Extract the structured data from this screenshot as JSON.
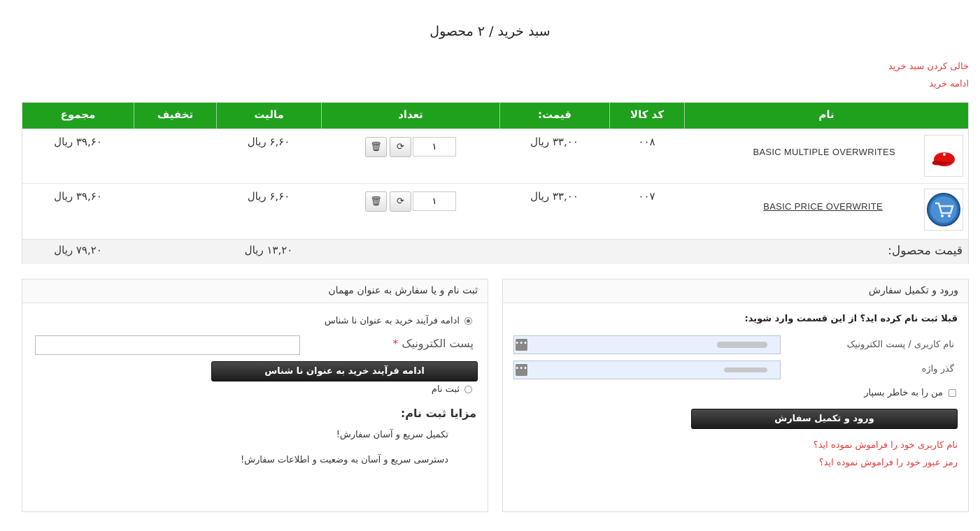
{
  "page": {
    "title": "سبد خرید / ۲ محصول"
  },
  "links": {
    "empty_cart": "خالی کردن سبد خرید",
    "continue_shopping": "ادامه خرید"
  },
  "table": {
    "headers": {
      "name": "نام",
      "sku": "کد کالا",
      "price": "قیمت:",
      "qty": "تعداد",
      "tax": "مالیت",
      "discount": "تخفیف",
      "total": "مجموع"
    },
    "rows": [
      {
        "name": "BASIC MULTIPLE OVERWRITES",
        "sku": "۰۰۸",
        "price": "۳۳,۰۰ ریال",
        "qty": "۱",
        "tax": "۶,۶۰ ریال",
        "discount": "",
        "total": "۳۹,۶۰ ریال",
        "image": "red-cap-icon"
      },
      {
        "name": "BASIC PRICE OVERWRITE",
        "sku": "۰۰۷",
        "price": "۳۳,۰۰ ریال",
        "qty": "۱",
        "tax": "۶,۶۰ ریال",
        "discount": "",
        "total": "۳۹,۶۰ ریال",
        "image": "shopping-cart-icon"
      }
    ],
    "summary": {
      "label": "قیمت محصول:",
      "tax": "۱۳,۲۰ ریال",
      "total": "۷۹,۲۰ ریال"
    }
  },
  "login": {
    "title": "ورود و تکمیل سفارش",
    "intro": "قبلا ثبت نام کرده اید؟ از این قسمت وارد شوید:",
    "username_label": "نام کاربری / پست الکترونیک",
    "password_label": "گذر واژه",
    "remember": "من را به خاطر بسپار",
    "submit": "ورود و تکمیل سفارش",
    "forgot_username": "نام کاربری خود را فراموش نموده اید؟",
    "forgot_password": "رمز عبور خود را فراموش نموده اید؟"
  },
  "guest": {
    "title": "ثبت نام و یا سفارش به عنوان مهمان",
    "guest_option": "ادامه فرآیند خرید به عنوان نا شناس",
    "email_label": "پست الکترونیک",
    "required_mark": "*",
    "guest_button": "ادامه فرآیند خرید به عنوان نا شناس",
    "register_option": "ثبت نام",
    "benefits_title": "مزایا ثبت نام:",
    "benefits": [
      "تکمیل سریع و آسان سفارش!",
      "دسترسی سریع و آسان به وضعیت و اطلاعات سفارش!"
    ]
  },
  "colors": {
    "header_green": "#1fa11d",
    "link_red": "#e53935"
  }
}
